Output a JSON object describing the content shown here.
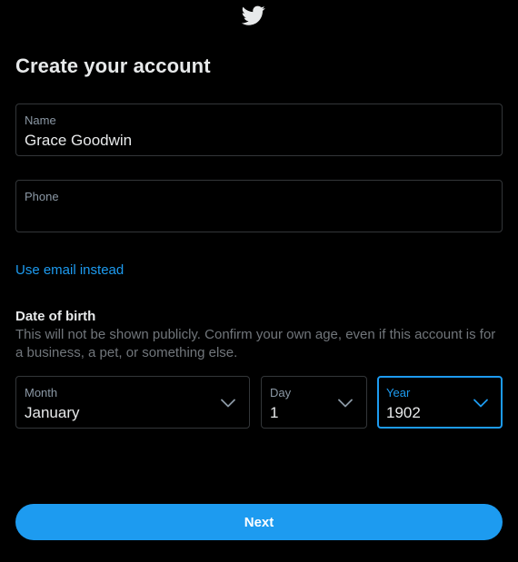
{
  "logo": {
    "icon": "twitter-bird-icon"
  },
  "title": "Create your account",
  "name_field": {
    "label": "Name",
    "value": "Grace Goodwin"
  },
  "phone_field": {
    "label": "Phone",
    "value": ""
  },
  "email_link": "Use email instead",
  "dob": {
    "title": "Date of birth",
    "description": "This will not be shown publicly. Confirm your own age, even if this account is for a business, a pet, or something else.",
    "month": {
      "label": "Month",
      "value": "January"
    },
    "day": {
      "label": "Day",
      "value": "1"
    },
    "year": {
      "label": "Year",
      "value": "1902"
    }
  },
  "next_button": "Next",
  "colors": {
    "accent": "#1d9bf0",
    "background": "#000000",
    "text": "#e7e9ea",
    "muted": "#71767b",
    "border": "#333639"
  }
}
